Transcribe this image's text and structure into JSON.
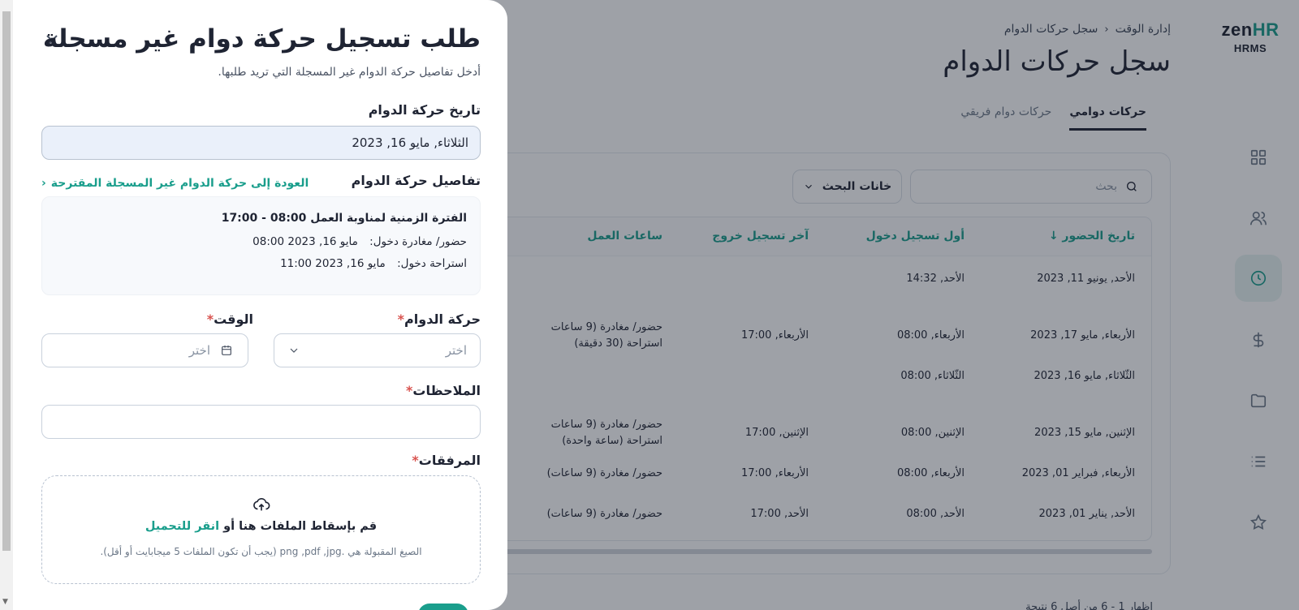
{
  "app": {
    "logo_main_prefix": "zen",
    "logo_main_suffix": "HR",
    "logo_sub": "HRMS"
  },
  "sidebar": {
    "icons": [
      "grid-icon",
      "users-icon",
      "clock-icon",
      "dollar-icon",
      "folder-icon",
      "list-icon",
      "star-icon"
    ],
    "active": "clock-icon"
  },
  "header": {
    "breadcrumb": [
      "إدارة الوقت",
      "سجل حركات الدوام"
    ],
    "title": "سجل حركات الدوام",
    "tabs": [
      {
        "label": "حركات دوامي",
        "active": true
      },
      {
        "label": "حركات دوام فريقي",
        "active": false
      }
    ]
  },
  "toolbar": {
    "search_placeholder": "بحث",
    "filter_label": "خانات البحث"
  },
  "table": {
    "columns": [
      "تاريخ الحضور",
      "أول تسجيل دخول",
      "آخر تسجيل خروج",
      "ساعات العمل"
    ],
    "rows": [
      {
        "date": "الأحد, يونيو 11, 2023",
        "first_in": "الأحد, 14:32",
        "last_out": "",
        "hours": [
          "",
          ""
        ]
      },
      {
        "date": "الأربعاء, مايو 17, 2023",
        "first_in": "الأربعاء, 08:00",
        "last_out": "الأربعاء, 17:00",
        "hours": [
          "حضور/ مغادرة (9 ساعات",
          "استراحة (30 دقيقة)"
        ]
      },
      {
        "date": "الثّلاثاء, مايو 16, 2023",
        "first_in": "الثّلاثاء, 08:00",
        "last_out": "",
        "hours": [
          "",
          ""
        ]
      },
      {
        "date": "الإثنين, مايو 15, 2023",
        "first_in": "الإثنين, 08:00",
        "last_out": "الإثنين, 17:00",
        "hours": [
          "حضور/ مغادرة (9 ساعات",
          "استراحة (ساعة واحدة)"
        ]
      },
      {
        "date": "الأربعاء, فبراير 01, 2023",
        "first_in": "الأربعاء, 08:00",
        "last_out": "الأربعاء, 17:00",
        "hours": [
          "حضور/ مغادرة (9 ساعات)",
          ""
        ]
      },
      {
        "date": "الأحد, يناير 01, 2023",
        "first_in": "الأحد, 08:00",
        "last_out": "الأحد, 17:00",
        "hours": [
          "حضور/ مغادرة (9 ساعات)",
          ""
        ]
      }
    ],
    "footer": "إظهار 1 - 6 من أصل 6 نتيجة"
  },
  "drawer": {
    "title": "طلب تسجيل حركة دوام غير مسجلة",
    "subtitle": "أدخل تفاصيل حركة الدوام غير المسجلة التي تريد طلبها.",
    "date_label": "تاريخ حركة الدوام",
    "date_value": "الثلاثاء, مايو 16, 2023",
    "details_label": "تفاصيل حركة الدوام",
    "back_link": "العودة إلى حركة الدوام غير المسجلة المقترحة",
    "shift": "الفترة الزمنية لمناوبة العمل 08:00 - 17:00",
    "entries": [
      {
        "key": "حضور/ مغادرة دخول:",
        "value": "مايو 16, 2023 08:00"
      },
      {
        "key": "استراحة دخول:",
        "value": "مايو 16, 2023 11:00"
      }
    ],
    "movement_label": "حركة الدوام",
    "movement_placeholder": "اختر",
    "time_label": "الوقت",
    "time_placeholder": "اختر",
    "notes_label": "الملاحظات",
    "attachments_label": "المرفقات",
    "upload_text": "قم بإسقاط الملفات هنا أو",
    "upload_link": "انقر للتحميل",
    "upload_hint": "الصيغ المقبولة هي .png ,pdf ,jpg (يجب أن تكون الملفات 5 ميجابايت أو أقل)."
  }
}
